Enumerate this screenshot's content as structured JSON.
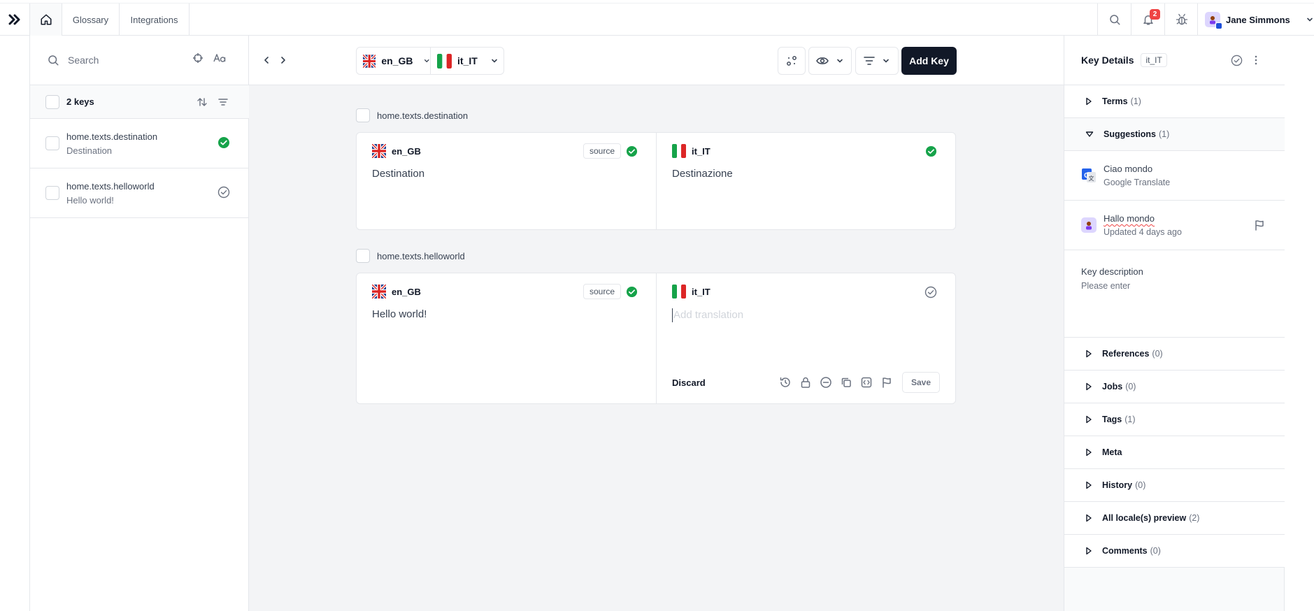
{
  "topnav": {
    "logo_icon": "double-chevron-right-icon",
    "home_icon": "home-icon",
    "links": [
      "Glossary",
      "Integrations"
    ],
    "notifications_count": "2",
    "user_name": "Jane Simmons"
  },
  "sidebar": {
    "search_placeholder": "Search",
    "keys_count": "2 keys",
    "keys": [
      {
        "key": "home.texts.destination",
        "value": "Destination",
        "status": "verified"
      },
      {
        "key": "home.texts.helloworld",
        "value": "Hello world!",
        "status": "unverified"
      }
    ]
  },
  "toolbar": {
    "source_locale": "en_GB",
    "target_locale": "it_IT",
    "add_key_label": "Add Key"
  },
  "editor": {
    "entries": [
      {
        "key": "home.texts.destination",
        "source_locale": "en_GB",
        "source_badge": "source",
        "source_text": "Destination",
        "target_locale": "it_IT",
        "target_text": "Destinazione"
      },
      {
        "key": "home.texts.helloworld",
        "source_locale": "en_GB",
        "source_badge": "source",
        "source_text": "Hello world!",
        "target_locale": "it_IT",
        "target_placeholder": "Add translation",
        "discard_label": "Discard",
        "save_label": "Save"
      }
    ]
  },
  "details": {
    "title": "Key Details",
    "locale": "it_IT",
    "terms": {
      "label": "Terms",
      "count": "(1)"
    },
    "suggestions": {
      "label": "Suggestions",
      "count": "(1)"
    },
    "suggestion_items": [
      {
        "text": "Ciao mondo",
        "source": "Google Translate"
      },
      {
        "text": "Hallo mondo",
        "source": "Updated 4 days ago"
      }
    ],
    "description_label": "Key description",
    "description_placeholder": "Please enter",
    "sections": [
      {
        "label": "References",
        "count": "(0)"
      },
      {
        "label": "Jobs",
        "count": "(0)"
      },
      {
        "label": "Tags",
        "count": "(1)"
      },
      {
        "label": "Meta",
        "count": ""
      },
      {
        "label": "History",
        "count": "(0)"
      },
      {
        "label": "All locale(s) preview",
        "count": "(2)"
      },
      {
        "label": "Comments",
        "count": "(0)"
      }
    ]
  },
  "colors": {
    "accent_dark": "#111827",
    "success": "#16a34a",
    "danger": "#ef4444"
  }
}
